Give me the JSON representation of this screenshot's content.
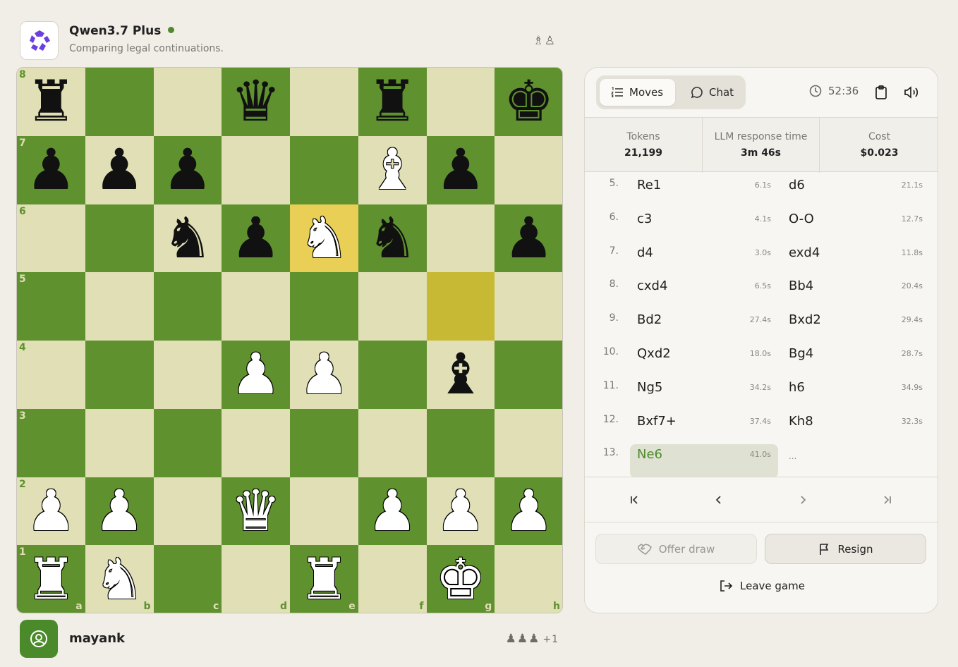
{
  "opponent": {
    "name": "Qwen3.7 Plus",
    "status": "Comparing legal continuations.",
    "captured": "♗♙"
  },
  "player": {
    "name": "mayank",
    "captured": "♟♟♟",
    "captured_extra": "+1"
  },
  "board": {
    "ranks": [
      "8",
      "7",
      "6",
      "5",
      "4",
      "3",
      "2",
      "1"
    ],
    "files": [
      "a",
      "b",
      "c",
      "d",
      "e",
      "f",
      "g",
      "h"
    ],
    "highlight_from": "g5",
    "highlight_to": "e6",
    "position": [
      [
        "bR",
        "",
        "",
        "bQ",
        "",
        "bR",
        "",
        "bK"
      ],
      [
        "bP",
        "bP",
        "bP",
        "",
        "",
        "wB",
        "bP",
        ""
      ],
      [
        "",
        "",
        "bN",
        "bP",
        "wN",
        "bN",
        "",
        "bP"
      ],
      [
        "",
        "",
        "",
        "",
        "",
        "",
        "",
        ""
      ],
      [
        "",
        "",
        "",
        "wP",
        "wP",
        "",
        "bB",
        ""
      ],
      [
        "",
        "",
        "",
        "",
        "",
        "",
        "",
        ""
      ],
      [
        "wP",
        "wP",
        "",
        "wQ",
        "",
        "wP",
        "wP",
        "wP"
      ],
      [
        "wR",
        "wN",
        "",
        "",
        "wR",
        "",
        "wK",
        ""
      ]
    ]
  },
  "panel": {
    "tabs": {
      "moves": "Moves",
      "chat": "Chat"
    },
    "clock": "52:36",
    "stats": [
      {
        "label": "Tokens",
        "value": "21,199"
      },
      {
        "label": "LLM response time",
        "value": "3m 46s"
      },
      {
        "label": "Cost",
        "value": "$0.023"
      }
    ],
    "moves": [
      {
        "num": "5.",
        "white": "Re1",
        "wt": "6.1s",
        "black": "d6",
        "bt": "21.1s"
      },
      {
        "num": "6.",
        "white": "c3",
        "wt": "4.1s",
        "black": "O-O",
        "bt": "12.7s"
      },
      {
        "num": "7.",
        "white": "d4",
        "wt": "3.0s",
        "black": "exd4",
        "bt": "11.8s"
      },
      {
        "num": "8.",
        "white": "cxd4",
        "wt": "6.5s",
        "black": "Bb4",
        "bt": "20.4s"
      },
      {
        "num": "9.",
        "white": "Bd2",
        "wt": "27.4s",
        "black": "Bxd2",
        "bt": "29.4s"
      },
      {
        "num": "10.",
        "white": "Qxd2",
        "wt": "18.0s",
        "black": "Bg4",
        "bt": "28.7s"
      },
      {
        "num": "11.",
        "white": "Ng5",
        "wt": "34.2s",
        "black": "h6",
        "bt": "34.9s"
      },
      {
        "num": "12.",
        "white": "Bxf7+",
        "wt": "37.4s",
        "black": "Kh8",
        "bt": "32.3s"
      },
      {
        "num": "13.",
        "white": "Ne6",
        "wt": "41.0s",
        "black": "...",
        "bt": ""
      }
    ],
    "offer_draw": "Offer draw",
    "resign": "Resign",
    "leave": "Leave game"
  },
  "colors": {
    "light_square": "#e0dfb5",
    "dark_square": "#5f912f",
    "highlight_from": "#c8b935",
    "highlight_to": "#e9cf55",
    "accent": "#4e8a2b"
  }
}
